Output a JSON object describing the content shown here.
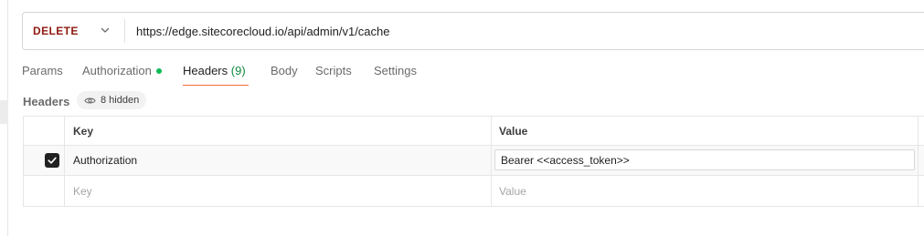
{
  "request": {
    "method": "DELETE",
    "url": "https://edge.sitecorecloud.io/api/admin/v1/cache"
  },
  "tabs": [
    {
      "label": "Params"
    },
    {
      "label": "Authorization",
      "status_dot": true
    },
    {
      "label": "Headers",
      "count": "(9)",
      "active": true
    },
    {
      "label": "Body"
    },
    {
      "label": "Scripts"
    },
    {
      "label": "Settings"
    }
  ],
  "headers_section": {
    "title": "Headers",
    "hidden_badge": "8 hidden",
    "columns": {
      "key": "Key",
      "value": "Value"
    },
    "rows": [
      {
        "enabled": true,
        "key": "Authorization",
        "value": "Bearer <<access_token>>"
      }
    ],
    "new_row": {
      "key_placeholder": "Key",
      "value_placeholder": "Value"
    }
  },
  "colors": {
    "method": "#8e1a10",
    "active_tab_underline": "#f26b3a",
    "status_dot": "#0cbb52",
    "count": "#0e8a3e"
  },
  "icons": {
    "method_dropdown": "chevron-down-icon",
    "hidden_badge": "eye-icon",
    "checkbox": "checkmark-icon"
  }
}
